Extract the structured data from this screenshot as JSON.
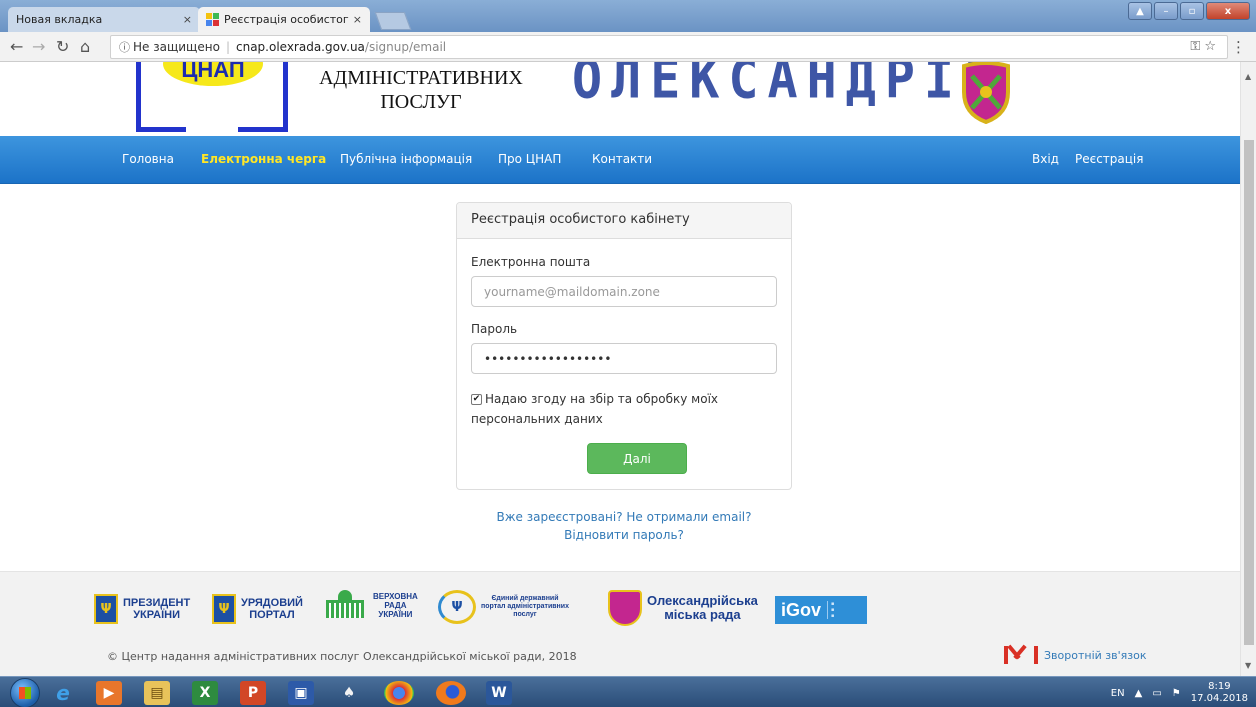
{
  "browser": {
    "tabs": [
      {
        "title": "Новая вкладка",
        "close": "×"
      },
      {
        "title": "Реєстрація особистого",
        "close": "×"
      }
    ],
    "address": {
      "security": "Не защищено",
      "host": "cnap.olexrada.gov.ua",
      "path": "/signup/email"
    }
  },
  "header": {
    "logo_text": "ЦНАП",
    "subtitle_line1": "АДМІНІСТРАТИВНИХ",
    "subtitle_line2": "ПОСЛУГ",
    "city_lettering": "ОЛЕКСАНДРІЯ"
  },
  "nav": {
    "items": [
      "Головна",
      "Електронна черга",
      "Публічна інформація",
      "Про ЦНАП",
      "Контакти"
    ],
    "active": "Електронна черга",
    "login": "Вхід",
    "register": "Реєстрація"
  },
  "signup": {
    "title": "Реєстрація особистого кабінету",
    "email_label": "Електронна пошта",
    "email_placeholder": "yourname@maildomain.zone",
    "password_label": "Пароль",
    "password_value": "••••••••••••••••••",
    "consent_checked": true,
    "consent_text": "Надаю згоду на збір та обробку моїх персональних даних",
    "submit": "Далі",
    "submit_color": "#5cb85c"
  },
  "links": {
    "registered": "Вже зареєстровані? Не отримали email?",
    "restore": "Відновити пароль?"
  },
  "footer": {
    "partners": {
      "president": [
        "ПРЕЗИДЕНТ",
        "УКРАЇНИ"
      ],
      "government": [
        "УРЯДОВИЙ",
        "ПОРТАЛ"
      ],
      "rada": [
        "ВЕРХОВНА",
        "РАДА",
        "УКРАЇНИ"
      ],
      "portal": [
        "Єдиний державний",
        "портал адміністративних",
        "послуг"
      ],
      "city": [
        "Олександрійська",
        "міська рада"
      ],
      "igov": "iGov"
    },
    "copyright": "© Центр надання адміністративних послуг Олександрійської міської ради, 2018",
    "feedback": "Зворотній зв'язок"
  },
  "taskbar": {
    "lang": "EN",
    "time": "8:19",
    "date": "17.04.2018"
  },
  "colors": {
    "nav_bg": "#1c73c8",
    "nav_active": "#ffe626",
    "link": "#337ab7"
  }
}
